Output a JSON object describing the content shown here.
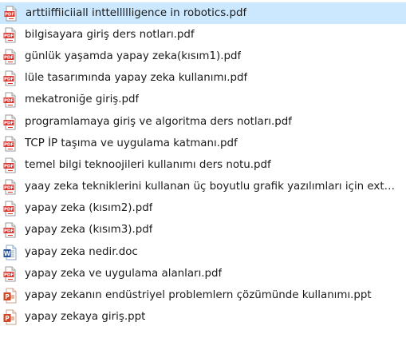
{
  "files": [
    {
      "name": "arttiiffiiciiall inttellllligence in robotics.pdf",
      "icon": "pdf-icon",
      "selected": true
    },
    {
      "name": "bilgisayara giriş ders notları.pdf",
      "icon": "pdf-icon"
    },
    {
      "name": "günlük yaşamda yapay zeka(kısım1).pdf",
      "icon": "pdf-icon"
    },
    {
      "name": "lüle tasarımında yapay zeka kullanımı.pdf",
      "icon": "pdf-icon"
    },
    {
      "name": "mekatroniğe giriş.pdf",
      "icon": "pdf-icon"
    },
    {
      "name": "programlamaya giriş ve algoritma ders notları.pdf",
      "icon": "pdf-icon"
    },
    {
      "name": "TCP İP taşıma ve uygulama katmanı.pdf",
      "icon": "pdf-icon"
    },
    {
      "name": "temel bilgi teknoojileri kullanımı ders notu.pdf",
      "icon": "pdf-icon"
    },
    {
      "name": "yaay zeka tekniklerini kullanan üç boyutlu grafik yazılımları için extensi...",
      "icon": "pdf-icon"
    },
    {
      "name": "yapay zeka (kısım2).pdf",
      "icon": "pdf-icon"
    },
    {
      "name": "yapay zeka (kısım3).pdf",
      "icon": "pdf-icon"
    },
    {
      "name": "yapay zeka nedir.doc",
      "icon": "word-doc-icon"
    },
    {
      "name": "yapay zeka ve uygulama alanları.pdf",
      "icon": "pdf-icon"
    },
    {
      "name": "yapay zekanın endüstriyel problemlern çözümünde kullanımı.ppt",
      "icon": "powerpoint-icon"
    },
    {
      "name": "yapay zekaya giriş.ppt",
      "icon": "powerpoint-icon"
    }
  ],
  "colors": {
    "selection": "#cce8ff",
    "pdf_red": "#d9352e",
    "word_blue": "#2b579a",
    "ppt_orange": "#d24726"
  }
}
